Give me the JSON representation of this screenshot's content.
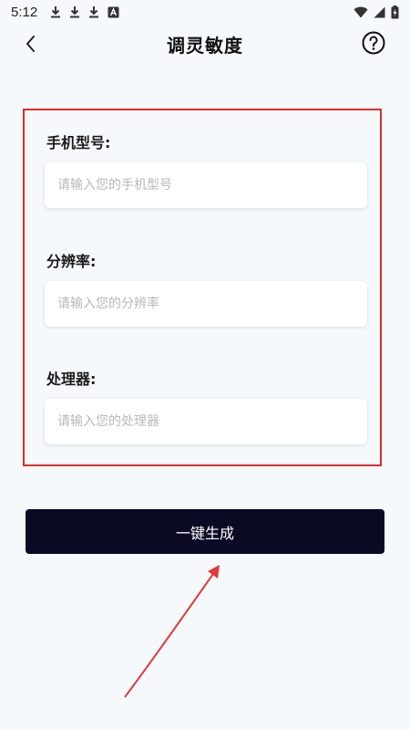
{
  "status_bar": {
    "time": "5:12",
    "left_icons": [
      "download-icon",
      "download-icon",
      "download-icon",
      "a-box-icon"
    ],
    "right_icons": [
      "wifi-icon",
      "signal-icon",
      "battery-charging-icon"
    ]
  },
  "header": {
    "title": "调灵敏度",
    "back_icon": "chevron-left-icon",
    "help_icon": "question-circle-icon"
  },
  "form": {
    "phone_model": {
      "label": "手机型号:",
      "value": "",
      "placeholder": "请输入您的手机型号"
    },
    "resolution": {
      "label": "分辨率:",
      "value": "",
      "placeholder": "请输入您的分辨率"
    },
    "processor": {
      "label": "处理器:",
      "value": "",
      "placeholder": "请输入您的处理器"
    }
  },
  "generate_button": {
    "label": "一键生成"
  },
  "colors": {
    "background": "#f5f9fc",
    "highlight_border": "#e02a2a",
    "button_bg": "#0a0a24",
    "annotation_arrow": "#e23a3a"
  }
}
